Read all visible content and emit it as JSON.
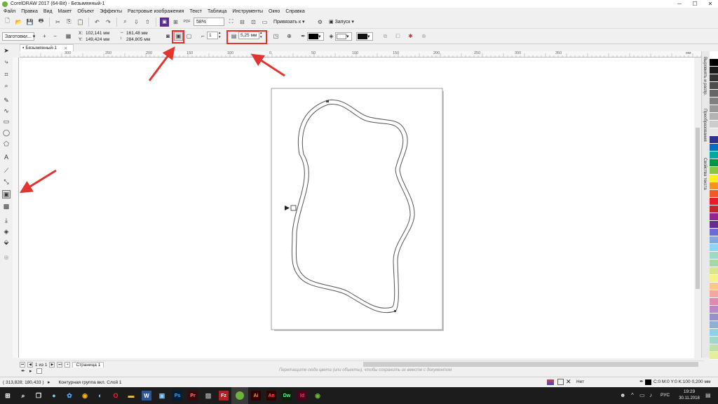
{
  "window": {
    "title": "CorelDRAW 2017 (64-Bit) - Безымянный-1",
    "min": "─",
    "max": "☐",
    "close": "✕"
  },
  "menu": [
    "Файл",
    "Правка",
    "Вид",
    "Макет",
    "Объект",
    "Эффекты",
    "Растровые изображения",
    "Текст",
    "Таблица",
    "Инструменты",
    "Окно",
    "Справка"
  ],
  "toolbar": {
    "zoom": "58%",
    "snap_label": "Привязать к",
    "launch_label": "Запуск"
  },
  "property_bar": {
    "preset": "Заготовки...",
    "x_label": "X:",
    "x_value": "102,141 мм",
    "y_label": "Y:",
    "y_value": "149,424 мм",
    "w_value": "161,48 мм",
    "h_value": "284,805 мм",
    "steps_value": "1",
    "offset_value": "5,25 мм"
  },
  "document": {
    "tab_name": "Безымянный-1"
  },
  "rulers": {
    "h_ticks": [
      "300",
      "250",
      "200",
      "150",
      "100",
      "50",
      "0",
      "50",
      "100",
      "150",
      "200",
      "250",
      "300",
      "350"
    ],
    "units": "мм"
  },
  "dockers": [
    "Выровнять и распр.",
    "Преобразования",
    "Свойства текста"
  ],
  "palette_colors": [
    "#ffffff",
    "#000000",
    "#1a1a1a",
    "#333333",
    "#4d4d4d",
    "#666666",
    "#808080",
    "#999999",
    "#b3b3b3",
    "#cccccc",
    "#e6e6e6",
    "#2e3192",
    "#0071bc",
    "#00a99d",
    "#009245",
    "#8cc63f",
    "#fcee21",
    "#f7931e",
    "#f15a24",
    "#ed1c24",
    "#c1272d",
    "#93278f",
    "#662d91",
    "#6b6bd6",
    "#7fa7e0",
    "#8fd3f4",
    "#9bdbc3",
    "#a7d8a0",
    "#d7e889",
    "#f6f08f",
    "#f9c98c",
    "#f4a6a0",
    "#e08ab0",
    "#b48ac7",
    "#9691c9",
    "#8ab2d9",
    "#8cd0ee",
    "#a0d7c8",
    "#c0e0a8",
    "#e7ed9e"
  ],
  "page_nav": {
    "counter": "1 из 1",
    "page_tab": "Страница 1"
  },
  "color_hint": "Перетащите сюда цвета (или объекты), чтобы сохранить их вместе с документом",
  "status": {
    "coords": "( 313,828; 180,433 )",
    "object_info": "Контурная группа вкл. Слой 1",
    "fill_label": "Нет",
    "outline_info": "C:0 M:0 Y:0 K:100  0,200 мм"
  },
  "taskbar": {
    "time": "19:29",
    "date": "30.11.2018",
    "lang": "РУС",
    "apps": [
      {
        "label": "Ps",
        "color": "#31a8ff",
        "bg": "#001e36"
      },
      {
        "label": "Pr",
        "color": "#ff7c7c",
        "bg": "#3a0a0a"
      },
      {
        "label": "Fz",
        "color": "#ffffff",
        "bg": "#b22222"
      },
      {
        "label": "Ai",
        "color": "#ff9a00",
        "bg": "#330000"
      },
      {
        "label": "An",
        "color": "#ff4f4f",
        "bg": "#330000"
      },
      {
        "label": "Dw",
        "color": "#4affb0",
        "bg": "#072401"
      },
      {
        "label": "Id",
        "color": "#ff3366",
        "bg": "#49021f"
      }
    ]
  },
  "accent": {
    "highlight": "#e3342f",
    "corel_green": "#6bb33a"
  }
}
